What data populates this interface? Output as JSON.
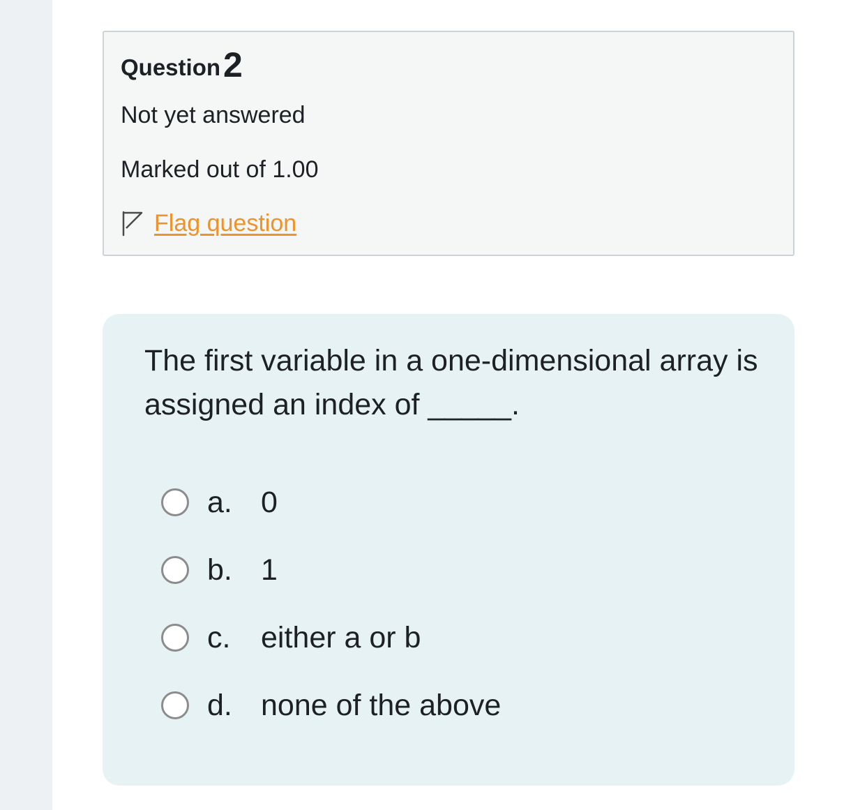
{
  "question_info": {
    "question_word": "Question",
    "question_number": "2",
    "state": "Not yet answered",
    "grade": "Marked out of 1.00",
    "flag_label": "Flag question"
  },
  "question": {
    "text": "The first variable in a one-dimensional array is assigned an index of _____.",
    "answers": [
      {
        "letter": "a.",
        "text": "0"
      },
      {
        "letter": "b.",
        "text": "1"
      },
      {
        "letter": "c.",
        "text": "either a or b"
      },
      {
        "letter": "d.",
        "text": "none of the above"
      }
    ]
  },
  "icons": {
    "flag": "flag-icon",
    "radio": "radio-unchecked-icon"
  },
  "colors": {
    "flag_link": "#f0922c",
    "info_background": "#f5f7f6",
    "formulation_background": "#e7f2f4"
  }
}
